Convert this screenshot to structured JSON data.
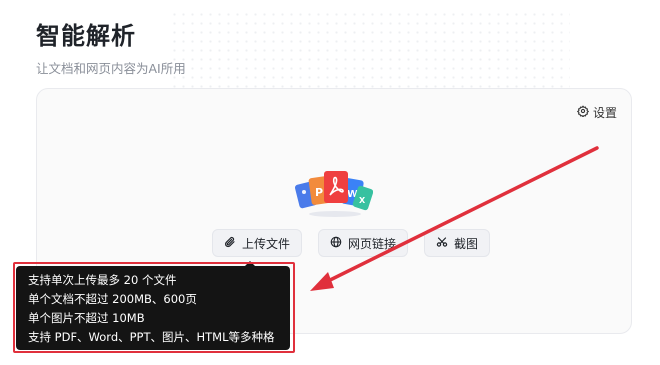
{
  "header": {
    "title": "智能解析",
    "subtitle": "让文档和网页内容为AI所用"
  },
  "panel": {
    "settings_label": "设置",
    "settings_icon": "gear-icon",
    "illustration_icon": "file-types-illustration",
    "buttons": [
      {
        "label": "上传文件",
        "icon": "paperclip-icon"
      },
      {
        "label": "网页链接",
        "icon": "globe-icon"
      },
      {
        "label": "截图",
        "icon": "scissors-icon"
      }
    ]
  },
  "tooltip": {
    "lines": [
      "支持单次上传最多 20 个文件",
      "单个文档不超过 200MB、600页",
      "单个图片不超过 10MB",
      "支持 PDF、Word、PPT、图片、HTML等多种格式"
    ]
  },
  "annotation": {
    "color": "#e0303c"
  }
}
